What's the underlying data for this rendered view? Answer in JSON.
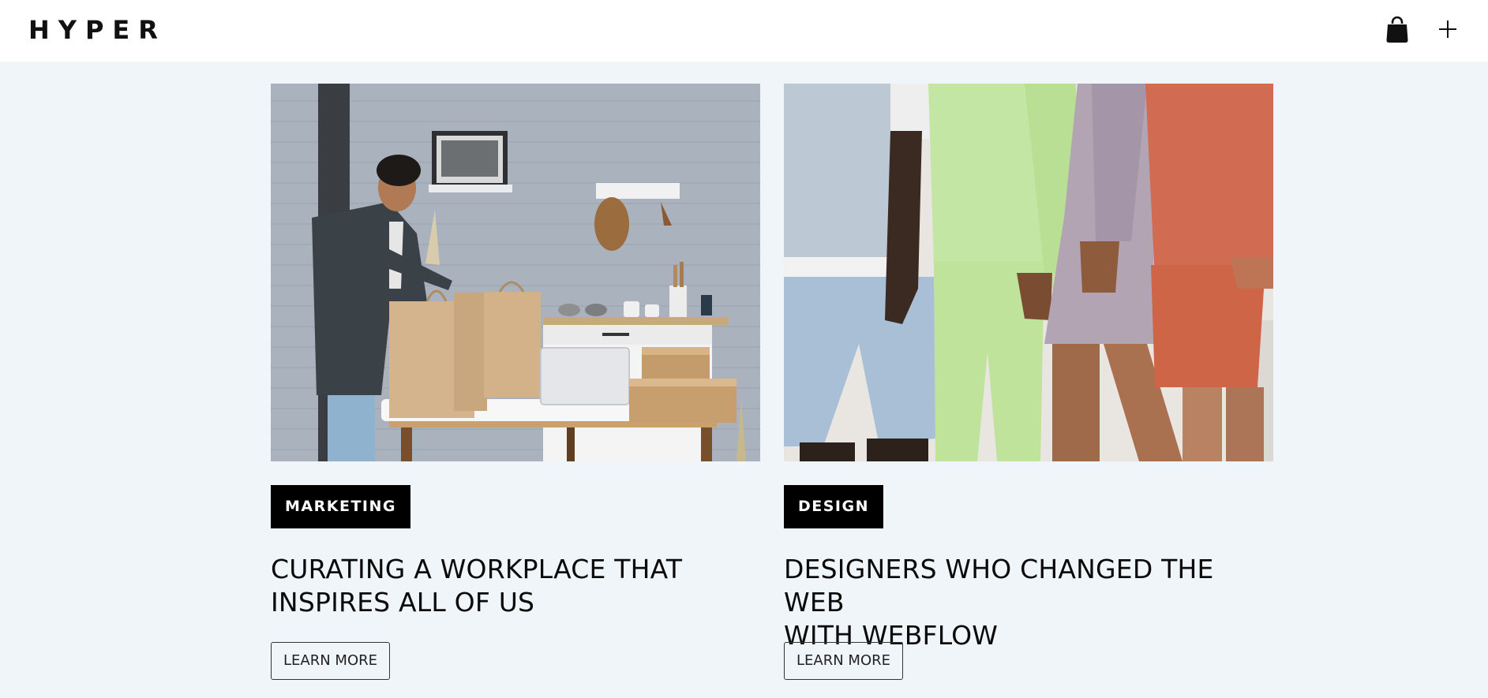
{
  "header": {
    "logo": "HYPER",
    "icons": [
      "shopping-bag-icon",
      "plus-icon"
    ]
  },
  "posts": [
    {
      "category": "MARKETING",
      "title_line1": "CURATING A WORKPLACE THAT",
      "title_line2": "INSPIRES ALL OF US",
      "button": "LEARN MORE",
      "image": "man-packing-paper-bags-photo"
    },
    {
      "category": "DESIGN",
      "title_line1": "DESIGNERS WHO CHANGED THE WEB",
      "title_line2": "WITH WEBFLOW",
      "button": "LEARN MORE",
      "image": "people-in-pastel-sweatsuits-photo"
    }
  ],
  "colors": {
    "page_background": "#f0f5f9",
    "header_background": "#ffffff",
    "tag_background": "#000000",
    "text": "#0a0a0a"
  }
}
